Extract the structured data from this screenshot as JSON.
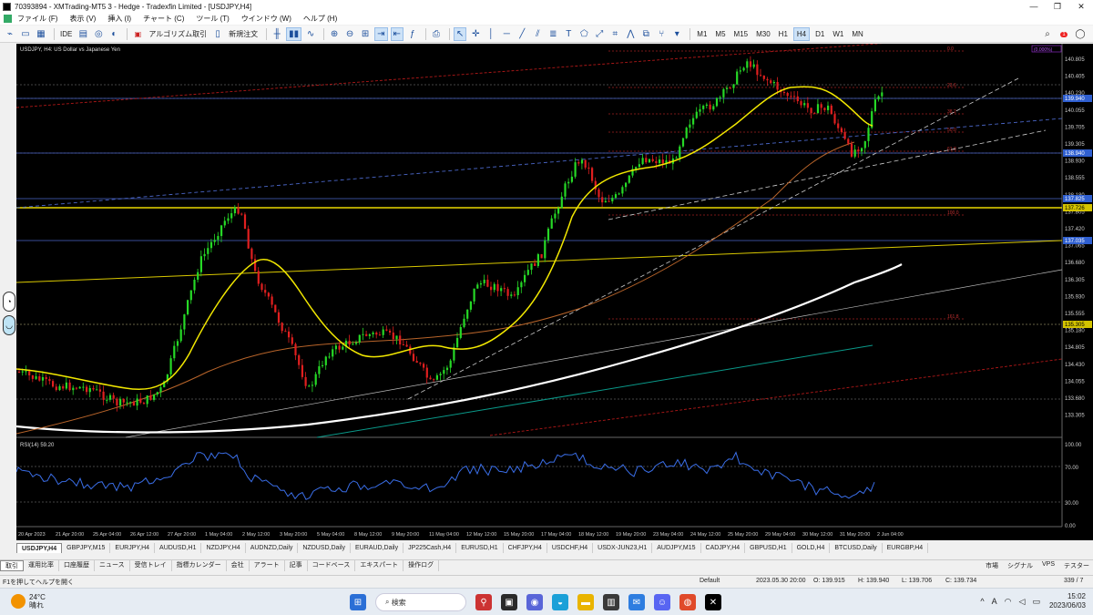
{
  "window": {
    "title": "70393894 - XMTrading-MT5 3 - Hedge - Tradexfin Limited - [USDJPY,H4]",
    "controls": [
      "—",
      "❐",
      "✕"
    ]
  },
  "menu": [
    "ファイル (F)",
    "表示 (V)",
    "挿入 (I)",
    "チャート (C)",
    "ツール (T)",
    "ウインドウ (W)",
    "ヘルプ (H)"
  ],
  "toolbar": {
    "ide": "IDE",
    "algo": "アルゴリズム取引",
    "neworder": "新規注文",
    "timeframes": [
      "M1",
      "M5",
      "M15",
      "M30",
      "H1",
      "H4",
      "D1",
      "W1",
      "MN"
    ],
    "selected_tf": "H4",
    "notif_count": "1"
  },
  "chart": {
    "symbol_label": "USDJPY, H4:  US Dollar vs Japanese Yen",
    "rsi_label": "RSI(14) 59.20",
    "price_levels": [
      "140.805",
      "140.405",
      "140.230",
      "140.055",
      "139.705",
      "139.305",
      "138.930",
      "138.555",
      "138.180",
      "137.805",
      "137.420",
      "137.065",
      "136.680",
      "136.305",
      "135.930",
      "135.555",
      "135.180",
      "134.805",
      "134.430",
      "134.055",
      "133.680",
      "133.305",
      "100.00",
      "70.00",
      "30.00",
      "0.00"
    ],
    "price_tags": [
      {
        "label": "139.940",
        "color": "#2f5fd0"
      },
      {
        "label": "138.940",
        "color": "#2f5fd0"
      },
      {
        "label": "137.825",
        "color": "#2f5fd0"
      },
      {
        "label": "137.726",
        "color": "#d4c400"
      },
      {
        "label": "137.035",
        "color": "#2f5fd0"
      },
      {
        "label": "135.305",
        "color": "#d4c400"
      }
    ],
    "top_right_tag": "(0.000%)",
    "fib_labels": [
      "0.0",
      "23.6",
      "38.2",
      "50.0",
      "61.8",
      "100.0",
      "161.8"
    ],
    "date_labels": [
      "20 Apr 2023",
      "21 Apr 20:00",
      "25 Apr 04:00",
      "26 Apr 12:00",
      "27 Apr 20:00",
      "1 May 04:00",
      "2 May 12:00",
      "3 May 20:00",
      "5 May 04:00",
      "8 May 12:00",
      "9 May 20:00",
      "11 May 04:00",
      "12 May 12:00",
      "15 May 20:00",
      "17 May 04:00",
      "18 May 12:00",
      "19 May 20:00",
      "23 May 04:00",
      "24 May 12:00",
      "25 May 20:00",
      "29 May 04:00",
      "30 May 12:00",
      "31 May 20:00",
      "2 Jun 04:00"
    ]
  },
  "chart_tabs": [
    "USDJPY,H4",
    "GBPJPY,M15",
    "EURJPY,H4",
    "AUDUSD,H1",
    "NZDJPY,H4",
    "AUDNZD,Daily",
    "NZDUSD,Daily",
    "EURAUD,Daily",
    "JP225Cash,H4",
    "EURUSD,H1",
    "CHFJPY,H4",
    "USDCHF,H4",
    "USDX-JUN23,H1",
    "AUDJPY,M15",
    "CADJPY,H4",
    "GBPUSD,H1",
    "GOLD,H4",
    "BTCUSD,Daily",
    "EURGBP,H4"
  ],
  "panel_tabs": [
    "取引",
    "運用比率",
    "口座履歴",
    "ニュース",
    "受信トレイ",
    "指標カレンダー",
    "会社",
    "アラート",
    "記事",
    "コードベース",
    "エキスパート",
    "操作ログ"
  ],
  "panel_right": [
    "市場",
    "シグナル",
    "VPS",
    "テスター"
  ],
  "status": {
    "help": "F1を押してヘルプを開く",
    "profile": "Default",
    "datetime": "2023.05.30 20:00",
    "open": "O: 139.915",
    "high": "H: 139.940",
    "low": "L: 139.706",
    "close": "C: 139.734",
    "conn": "339 / 7"
  },
  "taskbar": {
    "temp": "24°C",
    "weather": "晴れ",
    "search": "検索",
    "time": "15:02",
    "date": "2023/06/03"
  }
}
